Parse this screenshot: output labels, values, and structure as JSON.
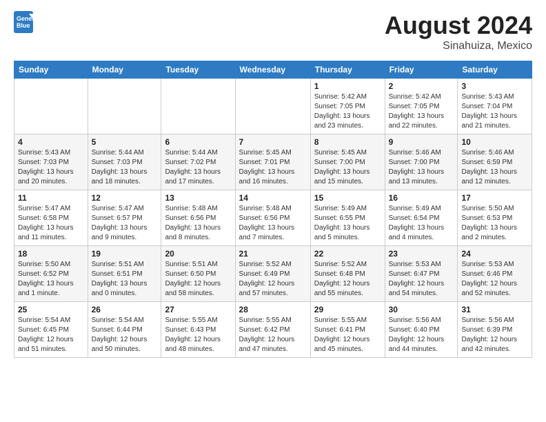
{
  "header": {
    "logo_general": "General",
    "logo_blue": "Blue",
    "month_year": "August 2024",
    "location": "Sinahuiza, Mexico"
  },
  "days_of_week": [
    "Sunday",
    "Monday",
    "Tuesday",
    "Wednesday",
    "Thursday",
    "Friday",
    "Saturday"
  ],
  "weeks": [
    [
      {
        "day": "",
        "info": ""
      },
      {
        "day": "",
        "info": ""
      },
      {
        "day": "",
        "info": ""
      },
      {
        "day": "",
        "info": ""
      },
      {
        "day": "1",
        "info": "Sunrise: 5:42 AM\nSunset: 7:05 PM\nDaylight: 13 hours\nand 23 minutes."
      },
      {
        "day": "2",
        "info": "Sunrise: 5:42 AM\nSunset: 7:05 PM\nDaylight: 13 hours\nand 22 minutes."
      },
      {
        "day": "3",
        "info": "Sunrise: 5:43 AM\nSunset: 7:04 PM\nDaylight: 13 hours\nand 21 minutes."
      }
    ],
    [
      {
        "day": "4",
        "info": "Sunrise: 5:43 AM\nSunset: 7:03 PM\nDaylight: 13 hours\nand 20 minutes."
      },
      {
        "day": "5",
        "info": "Sunrise: 5:44 AM\nSunset: 7:03 PM\nDaylight: 13 hours\nand 18 minutes."
      },
      {
        "day": "6",
        "info": "Sunrise: 5:44 AM\nSunset: 7:02 PM\nDaylight: 13 hours\nand 17 minutes."
      },
      {
        "day": "7",
        "info": "Sunrise: 5:45 AM\nSunset: 7:01 PM\nDaylight: 13 hours\nand 16 minutes."
      },
      {
        "day": "8",
        "info": "Sunrise: 5:45 AM\nSunset: 7:00 PM\nDaylight: 13 hours\nand 15 minutes."
      },
      {
        "day": "9",
        "info": "Sunrise: 5:46 AM\nSunset: 7:00 PM\nDaylight: 13 hours\nand 13 minutes."
      },
      {
        "day": "10",
        "info": "Sunrise: 5:46 AM\nSunset: 6:59 PM\nDaylight: 13 hours\nand 12 minutes."
      }
    ],
    [
      {
        "day": "11",
        "info": "Sunrise: 5:47 AM\nSunset: 6:58 PM\nDaylight: 13 hours\nand 11 minutes."
      },
      {
        "day": "12",
        "info": "Sunrise: 5:47 AM\nSunset: 6:57 PM\nDaylight: 13 hours\nand 9 minutes."
      },
      {
        "day": "13",
        "info": "Sunrise: 5:48 AM\nSunset: 6:56 PM\nDaylight: 13 hours\nand 8 minutes."
      },
      {
        "day": "14",
        "info": "Sunrise: 5:48 AM\nSunset: 6:56 PM\nDaylight: 13 hours\nand 7 minutes."
      },
      {
        "day": "15",
        "info": "Sunrise: 5:49 AM\nSunset: 6:55 PM\nDaylight: 13 hours\nand 5 minutes."
      },
      {
        "day": "16",
        "info": "Sunrise: 5:49 AM\nSunset: 6:54 PM\nDaylight: 13 hours\nand 4 minutes."
      },
      {
        "day": "17",
        "info": "Sunrise: 5:50 AM\nSunset: 6:53 PM\nDaylight: 13 hours\nand 2 minutes."
      }
    ],
    [
      {
        "day": "18",
        "info": "Sunrise: 5:50 AM\nSunset: 6:52 PM\nDaylight: 13 hours\nand 1 minute."
      },
      {
        "day": "19",
        "info": "Sunrise: 5:51 AM\nSunset: 6:51 PM\nDaylight: 13 hours\nand 0 minutes."
      },
      {
        "day": "20",
        "info": "Sunrise: 5:51 AM\nSunset: 6:50 PM\nDaylight: 12 hours\nand 58 minutes."
      },
      {
        "day": "21",
        "info": "Sunrise: 5:52 AM\nSunset: 6:49 PM\nDaylight: 12 hours\nand 57 minutes."
      },
      {
        "day": "22",
        "info": "Sunrise: 5:52 AM\nSunset: 6:48 PM\nDaylight: 12 hours\nand 55 minutes."
      },
      {
        "day": "23",
        "info": "Sunrise: 5:53 AM\nSunset: 6:47 PM\nDaylight: 12 hours\nand 54 minutes."
      },
      {
        "day": "24",
        "info": "Sunrise: 5:53 AM\nSunset: 6:46 PM\nDaylight: 12 hours\nand 52 minutes."
      }
    ],
    [
      {
        "day": "25",
        "info": "Sunrise: 5:54 AM\nSunset: 6:45 PM\nDaylight: 12 hours\nand 51 minutes."
      },
      {
        "day": "26",
        "info": "Sunrise: 5:54 AM\nSunset: 6:44 PM\nDaylight: 12 hours\nand 50 minutes."
      },
      {
        "day": "27",
        "info": "Sunrise: 5:55 AM\nSunset: 6:43 PM\nDaylight: 12 hours\nand 48 minutes."
      },
      {
        "day": "28",
        "info": "Sunrise: 5:55 AM\nSunset: 6:42 PM\nDaylight: 12 hours\nand 47 minutes."
      },
      {
        "day": "29",
        "info": "Sunrise: 5:55 AM\nSunset: 6:41 PM\nDaylight: 12 hours\nand 45 minutes."
      },
      {
        "day": "30",
        "info": "Sunrise: 5:56 AM\nSunset: 6:40 PM\nDaylight: 12 hours\nand 44 minutes."
      },
      {
        "day": "31",
        "info": "Sunrise: 5:56 AM\nSunset: 6:39 PM\nDaylight: 12 hours\nand 42 minutes."
      }
    ]
  ]
}
